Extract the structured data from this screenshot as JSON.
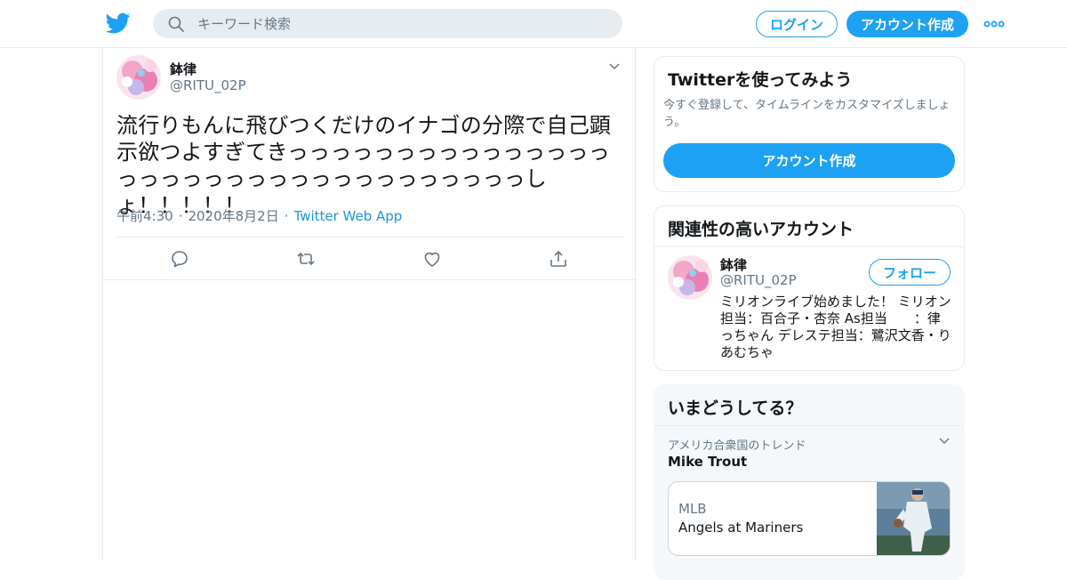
{
  "header": {
    "search_placeholder": "キーワード検索",
    "login_label": "ログイン",
    "signup_label": "アカウント作成"
  },
  "tweet": {
    "display_name": "鉢律",
    "handle": "@RITU_02P",
    "text": "流行りもんに飛びつくだけのイナゴの分際で自己顕示欲つよすぎてきっっっっっっっっっっっっっっっっっっっっっっっっっっっっっっっっっっしょ！！！！！",
    "time": "午前4:30",
    "date": "2020年8月2日",
    "source": "Twitter Web App"
  },
  "signup_card": {
    "title": "Twitterを使ってみよう",
    "description": "今すぐ登録して、タイムラインをカスタマイズしましょう。",
    "button_label": "アカウント作成"
  },
  "related_card": {
    "title": "関連性の高いアカウント",
    "account": {
      "display_name": "鉢律",
      "handle": "@RITU_02P",
      "follow_label": "フォロー",
      "bio": "ミリオンライブ始めました！ ミリオン担当：百合子・杏奈 As担当　　：律っちゃん デレステ担当：鷺沢文香・りあむちゃ"
    }
  },
  "trends_card": {
    "title": "いまどうしてる？",
    "trend_location": "アメリカ合衆国のトレンド",
    "trend_name": "Mike Trout",
    "news": {
      "category": "MLB",
      "headline": "Angels at Mariners"
    }
  },
  "colors": {
    "brand": "#1da1f2",
    "link": "#1b95e0",
    "secondary_text": "#657786",
    "border": "#e6ecf0"
  },
  "icons": [
    "twitter-bird-icon",
    "search-icon",
    "more-icon",
    "chevron-down-icon",
    "reply-icon",
    "retweet-icon",
    "like-icon",
    "share-icon"
  ]
}
